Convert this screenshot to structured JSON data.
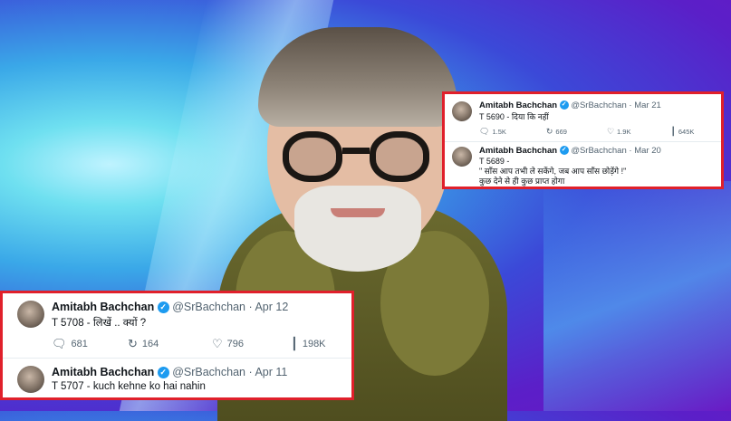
{
  "small_card": {
    "tweets": [
      {
        "name": "Amitabh Bachchan",
        "handle": "@SrBachchan",
        "separator": "·",
        "date": "Mar 21",
        "text_lines": [
          "T 5690 - दिया कि नहीं"
        ],
        "actions": {
          "replies": "1.5K",
          "reposts": "669",
          "likes": "1.9K",
          "views": "645K"
        }
      },
      {
        "name": "Amitabh Bachchan",
        "handle": "@SrBachchan",
        "separator": "·",
        "date": "Mar 20",
        "text_lines": [
          "T 5689 -",
          "\" साँस आप तभी ले सकेंगे, जब आप साँस छोड़ेंगे !\"",
          "कुछ देने  से ही कुछ प्राप्त होगा"
        ]
      }
    ]
  },
  "large_card": {
    "tweets": [
      {
        "name": "Amitabh Bachchan",
        "handle": "@SrBachchan",
        "separator": "·",
        "date": "Apr 12",
        "text": "T 5708 - लिखें .. क्यों ?",
        "actions": {
          "replies": "681",
          "reposts": "164",
          "likes": "796",
          "views": "198K"
        }
      },
      {
        "name": "Amitabh Bachchan",
        "handle": "@SrBachchan",
        "separator": "·",
        "date": "Apr 11",
        "text": "T 5707 - kuch kehne ko hai nahin"
      }
    ]
  },
  "icons": {
    "verified": "✓",
    "reply": "reply-icon",
    "repost": "repost-icon",
    "like": "like-icon",
    "views": "views-icon"
  },
  "colors": {
    "highlight_border": "#e0202b",
    "verified": "#1d9bf0"
  }
}
